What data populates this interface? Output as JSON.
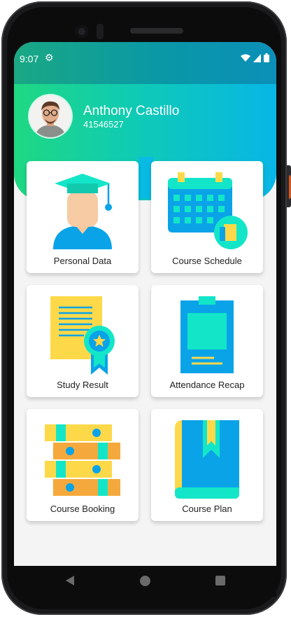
{
  "status_bar": {
    "time": "9:07",
    "settings_icon": "gear-icon",
    "wifi_icon": "wifi-icon",
    "signal_icon": "signal-icon",
    "battery_icon": "battery-icon"
  },
  "profile": {
    "name": "Anthony Castillo",
    "id_number": "41546527"
  },
  "menu": {
    "personal_data": "Personal Data",
    "course_schedule": "Course Schedule",
    "study_result": "Study Result",
    "attendance_recap": "Attendance Recap",
    "course_booking": "Course Booking",
    "course_plan": "Course Plan"
  },
  "colors": {
    "header_start": "#1fd882",
    "header_end": "#08b6e6",
    "accent_yellow": "#fdd94a",
    "accent_cyan": "#13e6c8",
    "accent_blue": "#0aa3e8"
  }
}
